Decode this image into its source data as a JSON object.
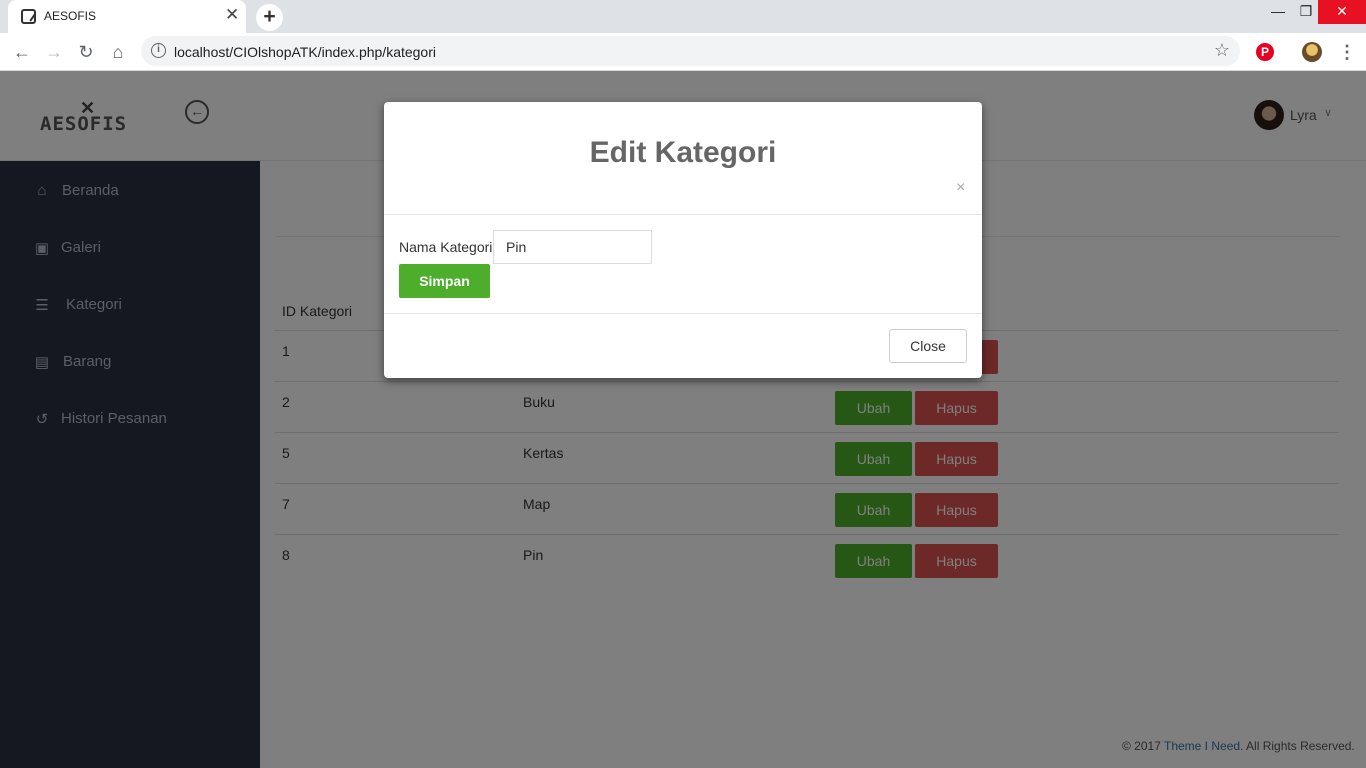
{
  "browser": {
    "tab_title": "AESOFIS",
    "tab_close": "✕",
    "new_tab": "+",
    "url": "localhost/CIOlshopATK/index.php/kategori",
    "window_controls": {
      "minimize": "—",
      "restore": "❐",
      "close": "✕"
    },
    "nav": {
      "back": "←",
      "forward": "→",
      "reload": "↻",
      "home": "⌂",
      "star": "☆",
      "menu": "⋮"
    },
    "extensions": {
      "pinterest": "P"
    }
  },
  "header": {
    "logo_mark": "✕",
    "logo_text": "AESOFIS",
    "toggle_icon": "←",
    "user_name": "Lyra",
    "user_caret": "∨"
  },
  "sidebar": {
    "items": [
      {
        "label": "Beranda",
        "icon": "home-icon",
        "glyph": "⌂"
      },
      {
        "label": "Galeri",
        "icon": "image-icon",
        "glyph": "▣"
      },
      {
        "label": "Kategori",
        "icon": "list-icon",
        "glyph": "☰"
      },
      {
        "label": "Barang",
        "icon": "table-icon",
        "glyph": "▤"
      },
      {
        "label": "Histori Pesanan",
        "icon": "history-icon",
        "glyph": "↺"
      }
    ]
  },
  "table": {
    "headers": {
      "id": "ID Kategori"
    },
    "rows": [
      {
        "id": "1",
        "name": ""
      },
      {
        "id": "2",
        "name": "Buku"
      },
      {
        "id": "5",
        "name": "Kertas"
      },
      {
        "id": "7",
        "name": "Map"
      },
      {
        "id": "8",
        "name": "Pin"
      }
    ],
    "edit_label": "Ubah",
    "delete_label": "Hapus"
  },
  "footer": {
    "prefix": "© 2017 ",
    "link": "Theme I Need",
    "suffix": ". All Rights Reserved."
  },
  "modal": {
    "title": "Edit Kategori",
    "close_x": "×",
    "field_label": "Nama Kategori",
    "field_value": "Pin",
    "save_label": "Simpan",
    "close_label": "Close"
  },
  "colors": {
    "sidebar_bg": "#2a3142",
    "success": "#4cae2b",
    "danger": "#d9534f",
    "link": "#3b6ea5"
  }
}
